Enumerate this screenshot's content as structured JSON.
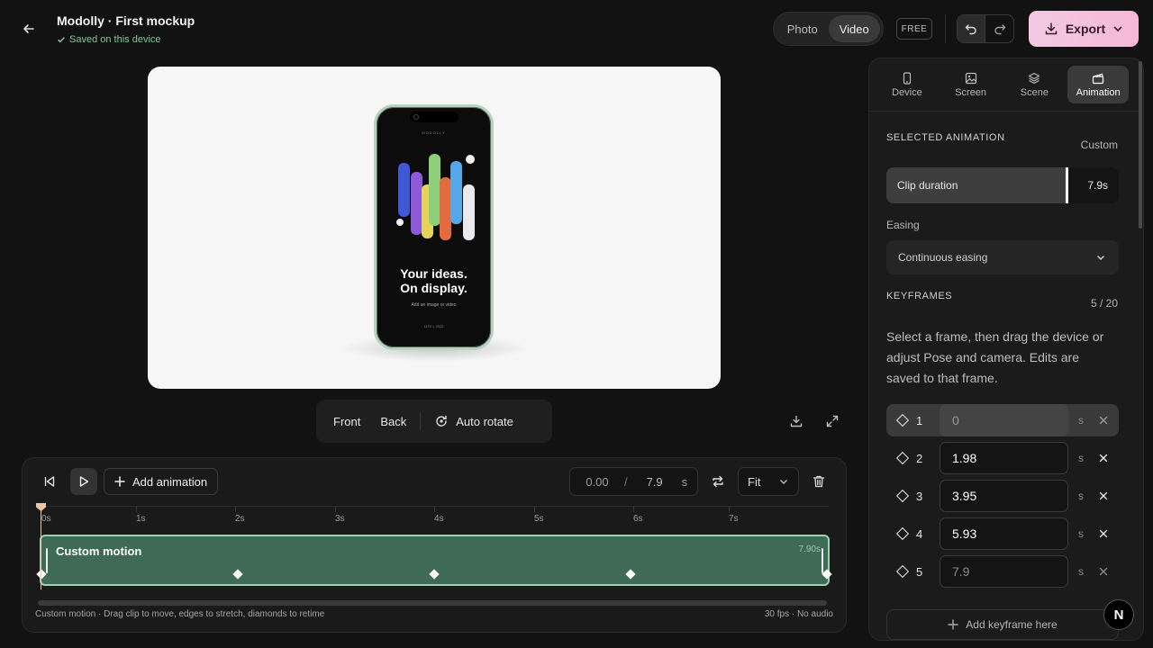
{
  "header": {
    "title": "Modolly · First mockup",
    "saved": "Saved on this device",
    "mode_tabs": [
      "Photo",
      "Video"
    ],
    "active_mode": "Video",
    "plan_badge": "FREE",
    "export_label": "Export"
  },
  "canvas": {
    "phone": {
      "brand": "MODOLLY",
      "headline_1": "Your ideas.",
      "headline_2": "On display.",
      "subtext": "Add an image or video",
      "dimensions": "1170 × 2532"
    }
  },
  "view_controls": {
    "front": "Front",
    "back": "Back",
    "auto_rotate": "Auto rotate"
  },
  "timeline": {
    "add_animation": "Add animation",
    "current_time": "0.00",
    "time_sep": "/",
    "total_time": "7.9",
    "time_unit": "s",
    "fit_label": "Fit",
    "ticks": [
      "0s",
      "1s",
      "2s",
      "3s",
      "4s",
      "5s",
      "6s",
      "7s"
    ],
    "clip_label": "Custom motion",
    "clip_duration": "7.90s",
    "footer_left": "Custom motion · Drag clip to move, edges to stretch, diamonds to retime",
    "footer_right": "30 fps · No audio"
  },
  "panel": {
    "tabs": [
      {
        "label": "Device",
        "icon": "device-icon"
      },
      {
        "label": "Screen",
        "icon": "image-icon"
      },
      {
        "label": "Scene",
        "icon": "layers-icon"
      },
      {
        "label": "Animation",
        "icon": "clapper-icon"
      }
    ],
    "active_tab": "Animation",
    "selected_heading": "SELECTED ANIMATION",
    "selected_value": "Custom",
    "clip_duration_label": "Clip duration",
    "clip_duration_value": "7.9s",
    "easing_label": "Easing",
    "easing_value": "Continuous easing",
    "keyframes_heading": "KEYFRAMES",
    "keyframes_count": "5 / 20",
    "help_text": "Select a frame, then drag the device or adjust Pose and camera. Edits are saved to that frame.",
    "keyframes": [
      {
        "num": "1",
        "value": "0",
        "unit": "s"
      },
      {
        "num": "2",
        "value": "1.98",
        "unit": "s"
      },
      {
        "num": "3",
        "value": "3.95",
        "unit": "s"
      },
      {
        "num": "4",
        "value": "5.93",
        "unit": "s"
      },
      {
        "num": "5",
        "value": "7.9",
        "unit": "s"
      }
    ],
    "add_keyframe": "Add keyframe here"
  },
  "badge": "N",
  "colors": {
    "accent_green": "#3f6b56",
    "export_pink": "#f5b8d6",
    "playhead": "#f2c6a5"
  }
}
